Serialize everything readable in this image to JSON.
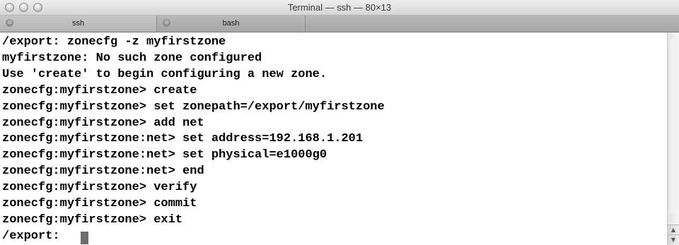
{
  "window": {
    "title": "Terminal — ssh — 80×13"
  },
  "tabs": [
    {
      "label": "ssh",
      "close_glyph": "⊗"
    },
    {
      "label": "bash",
      "close_glyph": "⊗"
    }
  ],
  "terminal": {
    "lines": [
      "/export: zonecfg -z myfirstzone",
      "myfirstzone: No such zone configured",
      "Use 'create' to begin configuring a new zone.",
      "zonecfg:myfirstzone> create",
      "zonecfg:myfirstzone> set zonepath=/export/myfirstzone",
      "zonecfg:myfirstzone> add net",
      "zonecfg:myfirstzone:net> set address=192.168.1.201",
      "zonecfg:myfirstzone:net> set physical=e1000g0",
      "zonecfg:myfirstzone:net> end",
      "zonecfg:myfirstzone> verify",
      "zonecfg:myfirstzone> commit",
      "zonecfg:myfirstzone> exit",
      "/export: "
    ]
  },
  "scrollbar": {
    "up_glyph": "▲",
    "down_glyph": "▼"
  },
  "colors": {
    "text": "#000000",
    "cursor": "#6e6e6e",
    "background": "#ffffff"
  }
}
